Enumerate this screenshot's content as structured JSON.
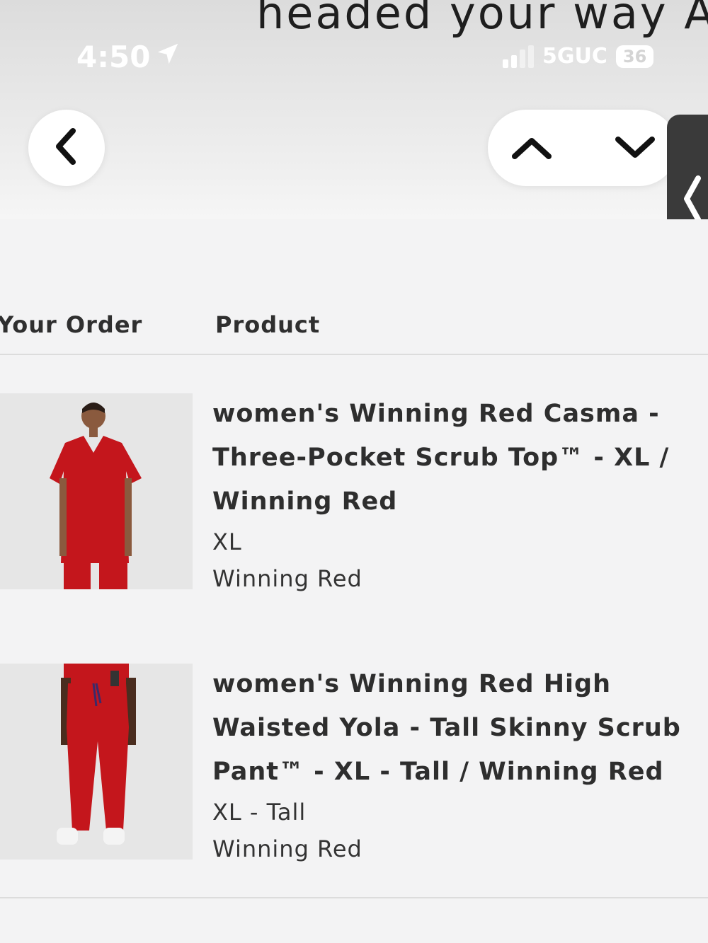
{
  "header": {
    "email_heading": "headed your way A"
  },
  "status_bar": {
    "time": "4:50",
    "network": "5GUC",
    "battery": "36"
  },
  "icons": {
    "location": "location-arrow-icon",
    "back": "chevron-left-icon",
    "up": "chevron-up-icon",
    "down": "chevron-down-icon",
    "handle": "chevron-left-icon"
  },
  "table": {
    "headers": [
      "Your Order",
      "Product"
    ],
    "items": [
      {
        "name": "women's Winning Red Casma - Three-Pocket Scrub Top™ - XL / Winning Red",
        "size": "XL",
        "color": "Winning Red"
      },
      {
        "name": "women's Winning Red High Waisted Yola - Tall Skinny Scrub Pant™ - XL - Tall / Winning Red",
        "size": "XL - Tall",
        "color": "Winning Red"
      }
    ]
  },
  "colors": {
    "product_red": "#c4161c",
    "background": "#f3f3f4"
  }
}
